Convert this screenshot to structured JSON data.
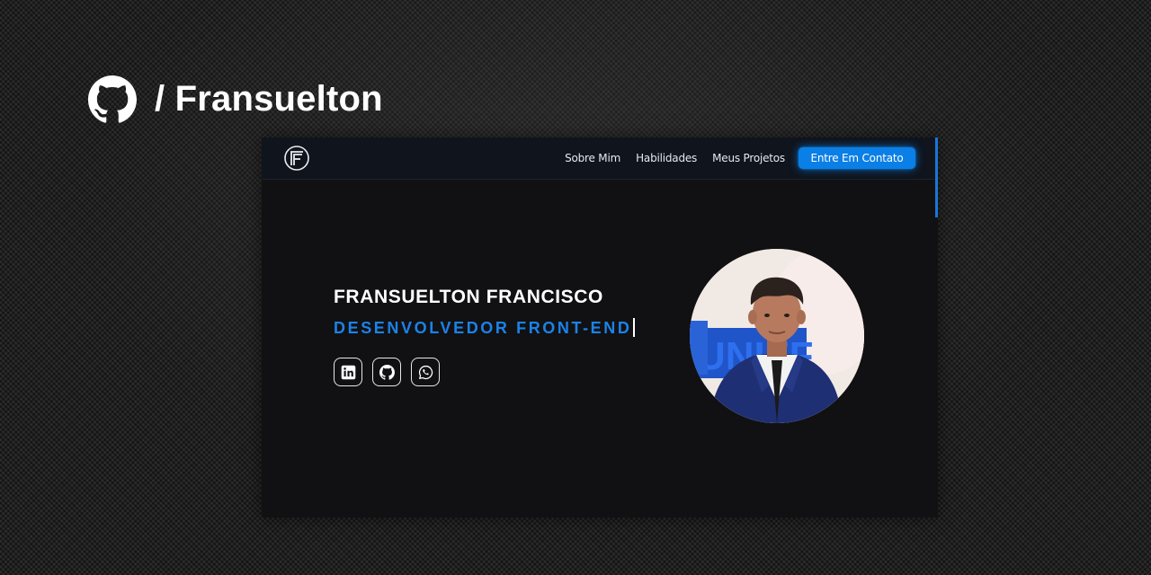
{
  "header": {
    "repo_title": "/ Fransuelton",
    "logo_icon": "github-icon"
  },
  "site": {
    "nav": {
      "logo_icon": "ff-monogram-logo",
      "links": [
        "Sobre Mim",
        "Habilidades",
        "Meus Projetos"
      ],
      "cta_label": "Entre Em Contato"
    },
    "hero": {
      "name": "FRANSUELTON FRANCISCO",
      "role": "DESENVOLVEDOR FRONT-END",
      "socials": [
        {
          "icon": "linkedin-icon"
        },
        {
          "icon": "github-icon"
        },
        {
          "icon": "whatsapp-icon"
        }
      ],
      "avatar": "profile-photo"
    }
  },
  "colors": {
    "accent": "#0a7fe6",
    "role_text": "#1c82e8",
    "site_bg": "#111113",
    "nav_bg": "#0f141d"
  }
}
